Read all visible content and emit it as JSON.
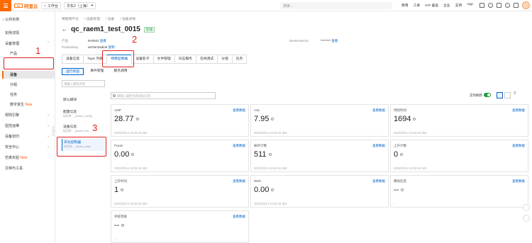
{
  "topbar": {
    "brand": "阿里云",
    "workbench": "工作台",
    "region": "华东2（上海）",
    "search_placeholder": "搜索...",
    "links": [
      "费用",
      "工单",
      "ICP 备案",
      "企业",
      "支持",
      "App"
    ]
  },
  "sidebar": {
    "top": "公共实例",
    "items": [
      {
        "label": "实例详情"
      },
      {
        "label": "设备管理"
      },
      {
        "label": "产品"
      },
      {
        "label": "设备"
      },
      {
        "label": "分组"
      },
      {
        "label": "任务"
      },
      {
        "label": "数字孪生",
        "badge": "New"
      },
      {
        "label": "规则引擎"
      },
      {
        "label": "监控运维"
      },
      {
        "label": "设备划归"
      },
      {
        "label": "安全中心"
      },
      {
        "label": "仿真实验",
        "badge": "New"
      },
      {
        "label": "文档与工具"
      }
    ]
  },
  "breadcrumbs": [
    "物联网平台",
    "设备管理",
    "设备",
    "设备详情"
  ],
  "device": {
    "name": "qc_raem1_test_0015",
    "status": "在线",
    "product_label": "产品",
    "product_value": "RAEM1",
    "product_link": "查看",
    "productkey_label": "ProductKey",
    "productkey_value": "a1PwnZwbob",
    "productkey_link": "复制",
    "secret_label": "DeviceSecret",
    "secret_value": "********",
    "secret_link": "查看"
  },
  "tabs": [
    "设备信息",
    "Topic 列表",
    "物模型数据",
    "设备影子",
    "文件管理",
    "日志服务",
    "在线调试",
    "分组",
    "任务"
  ],
  "subtabs": [
    "运行状态",
    "事件管理",
    "服务调用"
  ],
  "left_panel": {
    "search_placeholder": "请输入模块名称",
    "modules": [
      {
        "name": "默认模块",
        "sub": ""
      },
      {
        "name": "配置信息",
        "sub": "标识符：_device_config"
      },
      {
        "name": "设备信息",
        "sub": "标识符：_device_info"
      },
      {
        "name": "声光控制器",
        "sub": "标识符：_device_data"
      }
    ]
  },
  "toolbar": {
    "search_placeholder": "请输入属性名称或标识符",
    "realtime_label": "实时刷新"
  },
  "cards": [
    {
      "label": "AMP",
      "value": "28.77",
      "ts": "2022/03/14 10:28:44.363",
      "link": "查看数据"
    },
    {
      "label": "ASL",
      "value": "7.95",
      "ts": "2022/03/14 10:28:44.363",
      "link": "查看数据"
    },
    {
      "label": "持续时间",
      "value": "1694",
      "ts": "2022/03/14 10:28:44.363",
      "link": "查看数据"
    },
    {
      "label": "Power",
      "value": "0.00",
      "ts": "2022/03/14 10:28:44.363",
      "link": "查看数据"
    },
    {
      "label": "振铃计数",
      "value": "511",
      "ts": "2022/03/14 10:28:44.363",
      "link": "查看数据"
    },
    {
      "label": "上升计数",
      "value": "0",
      "ts": "2022/03/14 10:28:44.363",
      "link": "查看数据"
    },
    {
      "label": "上升时间",
      "value": "1",
      "ts": "2022/03/14 10:28:44.363",
      "link": "查看数据"
    },
    {
      "label": "RMS",
      "value": "0.00",
      "ts": "2022/03/14 10:28:44.363",
      "link": "查看数据"
    },
    {
      "label": "模拟信息",
      "value": "--",
      "ts": "--",
      "link": "查看数据"
    },
    {
      "label": "评级等级",
      "value": "--",
      "ts": "--",
      "link": "查看数据"
    }
  ],
  "annotations": [
    "1",
    "2",
    "3"
  ]
}
